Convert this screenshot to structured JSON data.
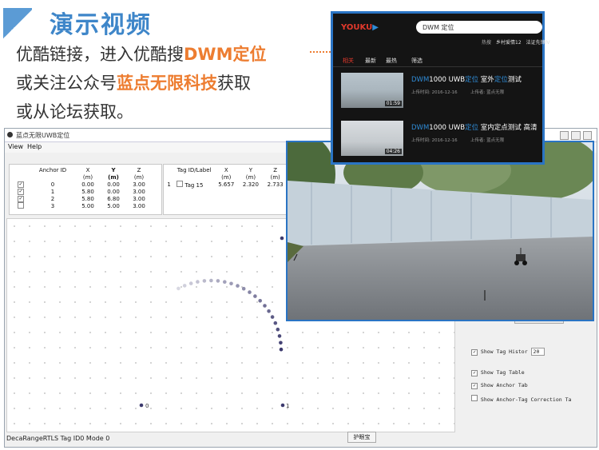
{
  "slide": {
    "title": "演示视频",
    "line1_prefix": "优酷链接，进入优酷搜",
    "line1_highlight": "DWM定位",
    "line2_prefix": "或关注公众号",
    "line2_highlight": "蓝点无限科技",
    "line2_suffix": "获取",
    "line3": "或从论坛获取。"
  },
  "app": {
    "title": "蓝点无限UWB定位",
    "menu": [
      "View",
      "Help"
    ],
    "anchor_table": {
      "headers": [
        "Anchor ID",
        "X",
        "Y",
        "Z"
      ],
      "units": [
        "",
        "(m)",
        "(m)",
        "(m)"
      ],
      "rows": [
        {
          "checked": true,
          "id": "0",
          "x": "0.00",
          "y": "0.00",
          "z": "3.00"
        },
        {
          "checked": true,
          "id": "1",
          "x": "5.80",
          "y": "0.00",
          "z": "3.00"
        },
        {
          "checked": true,
          "id": "2",
          "x": "5.80",
          "y": "6.80",
          "z": "3.00"
        },
        {
          "checked": false,
          "id": "3",
          "x": "5.00",
          "y": "5.00",
          "z": "3.00"
        }
      ]
    },
    "tag_table": {
      "headers": [
        "Tag ID/Label",
        "X",
        "Y",
        "Z"
      ],
      "units": [
        "",
        "(m)",
        "(m)",
        "(m)"
      ],
      "rows": [
        {
          "index": "1",
          "checked": false,
          "label": "Tag 15",
          "x": "5.657",
          "y": "2.320",
          "z": "2.733"
        }
      ]
    },
    "plot": {
      "anchor_labels": [
        "0",
        "1"
      ],
      "trail_count": 22
    },
    "options": {
      "show_tag_history_label": "Show Tag Histor",
      "show_tag_history_value": "20",
      "show_tag_table": "Show Tag Table",
      "show_anchor_tab": "Show Anchor Tab",
      "show_anchor_tag_correction": "Show Anchor-Tag Correction Ta"
    },
    "status": "DecaRangeRTLS Tag ID0 Mode 0",
    "guard_button": "护眼宝"
  },
  "youku": {
    "logo": "YOUKU",
    "search_value": "DWM 定位",
    "top_links": [
      "热搜",
      "乡村爱情12",
      "法证先锋IV"
    ],
    "tabs": [
      "相关",
      "最新",
      "最热",
      "筛选"
    ],
    "results": [
      {
        "title_a": "DWM",
        "title_b": "1000 UWB",
        "title_c": "定位",
        "title_d": " 室外",
        "title_e": "定位",
        "title_f": "测试",
        "duration": "01:59",
        "date": "上传时间: 2016-12-16",
        "author": "上传者: 蓝点无限"
      },
      {
        "title_a": "DWM",
        "title_b": "1000 UWB",
        "title_c": "定位",
        "title_d": " 室内定点测试 高清",
        "title_e": "",
        "title_f": "",
        "duration": "04:26",
        "date": "上传时间: 2016-12-16",
        "author": "上传者: 蓝点无限"
      }
    ]
  },
  "colors": {
    "title_blue": "#3e86c9",
    "highlight_orange": "#ed7d31",
    "youku_border": "#2a74c4",
    "youku_red": "#e3392c",
    "trail_purple": "#3c3a6e"
  }
}
